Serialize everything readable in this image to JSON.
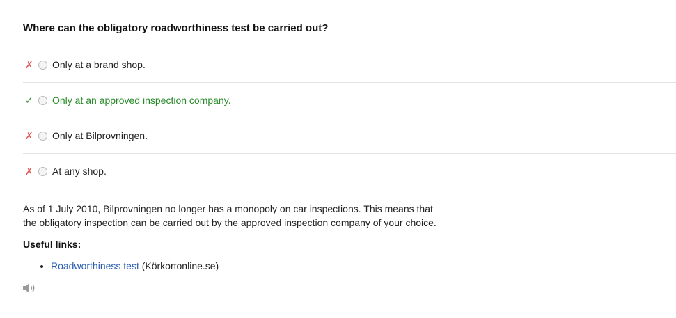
{
  "question": "Where can the obligatory roadworthiness test be carried out?",
  "answers": [
    {
      "mark": "✗",
      "text": "Only at a brand shop.",
      "correct": false
    },
    {
      "mark": "✓",
      "text": "Only at an approved inspection company.",
      "correct": true
    },
    {
      "mark": "✗",
      "text": "Only at Bilprovningen.",
      "correct": false
    },
    {
      "mark": "✗",
      "text": "At any shop.",
      "correct": false
    }
  ],
  "explanation": "As of 1 July 2010, Bilprovningen no longer has a monopoly on car inspections. This means that the obligatory inspection can be carried out by the approved inspection company of your choice.",
  "useful_links": {
    "heading": "Useful links:",
    "items": [
      {
        "link_text": "Roadworthiness test",
        "suffix": " (Körkortonline.se)"
      }
    ]
  },
  "icons": {
    "speaker": "speaker-icon",
    "wrong": "cross-icon",
    "right": "checkmark-icon"
  },
  "colors": {
    "wrong": "#e05a5a",
    "right": "#3a8a3a",
    "correct_text": "#2a8a2a",
    "link": "#2a5db0"
  }
}
